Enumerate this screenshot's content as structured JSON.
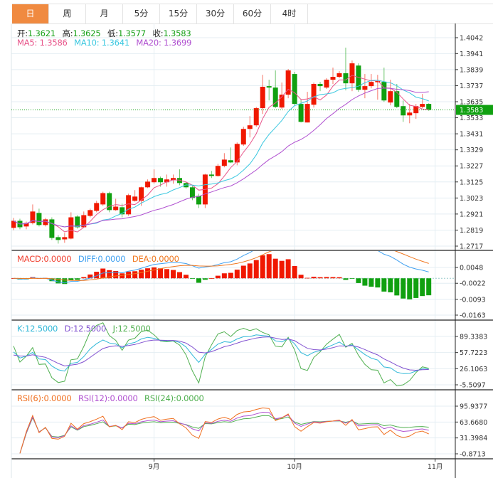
{
  "tabs": [
    {
      "label": "日",
      "active": true
    },
    {
      "label": "周"
    },
    {
      "label": "月"
    },
    {
      "label": "5分"
    },
    {
      "label": "15分"
    },
    {
      "label": "30分"
    },
    {
      "label": "60分"
    },
    {
      "label": "4时"
    }
  ],
  "legend_main": {
    "open_key": "开:",
    "open": "1.3621",
    "high_key": "高:",
    "high": "1.3625",
    "low_key": "低:",
    "low": "1.3577",
    "close_key": "收:",
    "close": "1.3583",
    "ma5": "MA5: 1.3586",
    "ma10": "MA10: 1.3641",
    "ma20": "MA20: 1.3699"
  },
  "legend_macd": {
    "macd": "MACD:0.0000",
    "diff": "DIFF:0.0000",
    "dea": "DEA:0.0000"
  },
  "legend_kdj": {
    "k": "K:12.5000",
    "d": "D:12.5000",
    "j": "J:12.5000"
  },
  "legend_rsi": {
    "rsi6": "RSI(6):0.0000",
    "rsi12": "RSI(12):0.0000",
    "rsi24": "RSI(24):0.0000"
  },
  "colors": {
    "up": "#f01800",
    "down": "#10a010",
    "active_tab": "#f08a40",
    "ma5": "#e8558a",
    "ma10": "#3cc8e0",
    "ma20": "#b050d0",
    "macd": "#f04030",
    "diff": "#3fa0f0",
    "dea": "#f07820",
    "k": "#30b8d8",
    "d": "#8050d0",
    "j": "#50b050",
    "rsi6": "#f07020",
    "rsi12": "#b050d0",
    "rsi24": "#50b050"
  },
  "chart_data": {
    "type": "candlestick",
    "last_price": "1.3583",
    "y_ticks": [
      "1.4042",
      "1.3941",
      "1.3839",
      "1.3737",
      "1.3635",
      "1.3533",
      "1.3431",
      "1.3329",
      "1.3227",
      "1.3125",
      "1.3023",
      "1.2921",
      "1.2819",
      "1.2717"
    ],
    "macd_ticks": [
      "0.0048",
      "-0.0022",
      "-0.0093",
      "-0.0163"
    ],
    "kdj_ticks": [
      "89.3383",
      "57.7223",
      "26.1063",
      "-5.5097"
    ],
    "rsi_ticks": [
      "95.9377",
      "63.6680",
      "31.3984",
      "-0.8713"
    ],
    "x_labels": [
      {
        "label": "9月",
        "index": 22
      },
      {
        "label": "10月",
        "index": 44
      },
      {
        "label": "11月",
        "index": 66
      }
    ],
    "ohlc": [
      [
        1.2833,
        1.2896,
        1.2819,
        1.2878
      ],
      [
        1.2878,
        1.2891,
        1.2824,
        1.2837
      ],
      [
        1.2842,
        1.2873,
        1.2824,
        1.2864
      ],
      [
        1.2864,
        1.2982,
        1.2855,
        1.2937
      ],
      [
        1.2928,
        1.2955,
        1.2842,
        1.2851
      ],
      [
        1.2851,
        1.2896,
        1.2842,
        1.2887
      ],
      [
        1.2887,
        1.29,
        1.2756,
        1.2769
      ],
      [
        1.2774,
        1.2787,
        1.2733,
        1.2756
      ],
      [
        1.276,
        1.2801,
        1.2738,
        1.2774
      ],
      [
        1.2765,
        1.2932,
        1.276,
        1.29
      ],
      [
        1.2905,
        1.2914,
        1.2828,
        1.2837
      ],
      [
        1.2837,
        1.2937,
        1.2833,
        1.2914
      ],
      [
        1.2909,
        1.2955,
        1.29,
        1.2946
      ],
      [
        1.2941,
        1.3005,
        1.2932,
        1.2991
      ],
      [
        1.2982,
        1.3063,
        1.2973,
        1.3054
      ],
      [
        1.3054,
        1.3063,
        1.2932,
        1.2946
      ],
      [
        1.2946,
        1.3018,
        1.2941,
        1.2968
      ],
      [
        1.2964,
        1.2987,
        1.29,
        1.2919
      ],
      [
        1.2919,
        1.305,
        1.2909,
        1.3041
      ],
      [
        1.3005,
        1.3073,
        1.3,
        1.3032
      ],
      [
        1.3005,
        1.3095,
        1.2973,
        1.3091
      ],
      [
        1.3091,
        1.3141,
        1.3086,
        1.3127
      ],
      [
        1.3123,
        1.3205,
        1.3114,
        1.315
      ],
      [
        1.315,
        1.3159,
        1.3095,
        1.3123
      ],
      [
        1.3123,
        1.3172,
        1.3095,
        1.3141
      ],
      [
        1.3136,
        1.3172,
        1.3114,
        1.315
      ],
      [
        1.315,
        1.3205,
        1.3104,
        1.3118
      ],
      [
        1.3118,
        1.3127,
        1.3082,
        1.3091
      ],
      [
        1.3091,
        1.31,
        1.3009,
        1.3023
      ],
      [
        1.3036,
        1.305,
        1.2959,
        1.2982
      ],
      [
        1.2982,
        1.3177,
        1.2959,
        1.3172
      ],
      [
        1.3172,
        1.3195,
        1.315,
        1.3163
      ],
      [
        1.3163,
        1.324,
        1.3159,
        1.3227
      ],
      [
        1.3227,
        1.3308,
        1.3218,
        1.3267
      ],
      [
        1.3263,
        1.3344,
        1.3245,
        1.3249
      ],
      [
        1.3249,
        1.3376,
        1.3231,
        1.3367
      ],
      [
        1.3363,
        1.3476,
        1.3354,
        1.3462
      ],
      [
        1.3462,
        1.3544,
        1.3408,
        1.3485
      ],
      [
        1.3485,
        1.3602,
        1.3476,
        1.3594
      ],
      [
        1.3594,
        1.3806,
        1.3557,
        1.373
      ],
      [
        1.3734,
        1.3775,
        1.3643,
        1.3725
      ],
      [
        1.3725,
        1.3834,
        1.3594,
        1.3602
      ],
      [
        1.3598,
        1.3757,
        1.3589,
        1.368
      ],
      [
        1.368,
        1.3843,
        1.3657,
        1.3834
      ],
      [
        1.3811,
        1.3825,
        1.3612,
        1.3621
      ],
      [
        1.3621,
        1.3648,
        1.3503,
        1.3507
      ],
      [
        1.3503,
        1.3698,
        1.3503,
        1.3621
      ],
      [
        1.3616,
        1.3757,
        1.3598,
        1.3748
      ],
      [
        1.3748,
        1.3761,
        1.3702,
        1.3734
      ],
      [
        1.3725,
        1.3784,
        1.3716,
        1.3775
      ],
      [
        1.3775,
        1.3852,
        1.3748,
        1.3793
      ],
      [
        1.3793,
        1.3829,
        1.3784,
        1.3816
      ],
      [
        1.3816,
        1.3979,
        1.3707,
        1.3752
      ],
      [
        1.3752,
        1.3897,
        1.3702,
        1.3879
      ],
      [
        1.3865,
        1.3879,
        1.3698,
        1.3711
      ],
      [
        1.3711,
        1.3811,
        1.3657,
        1.3734
      ],
      [
        1.3734,
        1.3811,
        1.372,
        1.3761
      ],
      [
        1.3761,
        1.3806,
        1.3648,
        1.3766
      ],
      [
        1.3761,
        1.3852,
        1.3634,
        1.3643
      ],
      [
        1.363,
        1.3775,
        1.3612,
        1.3702
      ],
      [
        1.3702,
        1.3748,
        1.3594,
        1.3602
      ],
      [
        1.3607,
        1.3643,
        1.3507,
        1.3548
      ],
      [
        1.3548,
        1.3621,
        1.3498,
        1.3566
      ],
      [
        1.3562,
        1.3621,
        1.3526,
        1.3607
      ],
      [
        1.3602,
        1.3684,
        1.3594,
        1.3621
      ],
      [
        1.3621,
        1.3625,
        1.3577,
        1.3583
      ]
    ]
  }
}
